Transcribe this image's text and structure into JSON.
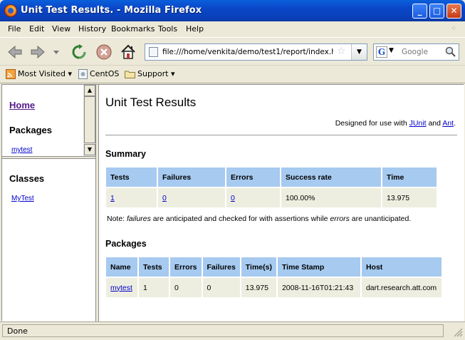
{
  "window": {
    "title": "Unit Test Results. - Mozilla Firefox",
    "minimize": "_",
    "maximize": "□",
    "close": "✕"
  },
  "menu": [
    "File",
    "Edit",
    "View",
    "History",
    "Bookmarks",
    "Tools",
    "Help"
  ],
  "nav": {
    "url": "file:///home/venkita/demo/test1/report/index.html",
    "search_placeholder": "Google",
    "search_engine_letter": "G"
  },
  "bookmarks": [
    "Most Visited",
    "CentOS",
    "Support"
  ],
  "left_frame": {
    "home": "Home",
    "packages_heading": "Packages",
    "packages": [
      "mytest"
    ],
    "classes_heading": "Classes",
    "classes": [
      "MyTest"
    ]
  },
  "main": {
    "title": "Unit Test Results",
    "designed_prefix": "Designed for use with ",
    "junit": "JUnit",
    "and": " and ",
    "ant": "Ant",
    "period": ".",
    "summary_heading": "Summary",
    "summary_headers": [
      "Tests",
      "Failures",
      "Errors",
      "Success rate",
      "Time"
    ],
    "summary_row": [
      "1",
      "0",
      "0",
      "100.00%",
      "13.975"
    ],
    "note_prefix": "Note: ",
    "note_failures": "failures",
    "note_mid": " are anticipated and checked for with assertions while ",
    "note_errors": "errors",
    "note_suffix": " are unanticipated.",
    "packages_heading": "Packages",
    "packages_headers": [
      "Name",
      "Tests",
      "Errors",
      "Failures",
      "Time(s)",
      "Time Stamp",
      "Host"
    ],
    "packages_row": [
      "mytest",
      "1",
      "0",
      "0",
      "13.975",
      "2008-11-16T01:21:43",
      "dart.research.att.com"
    ]
  },
  "status": "Done"
}
